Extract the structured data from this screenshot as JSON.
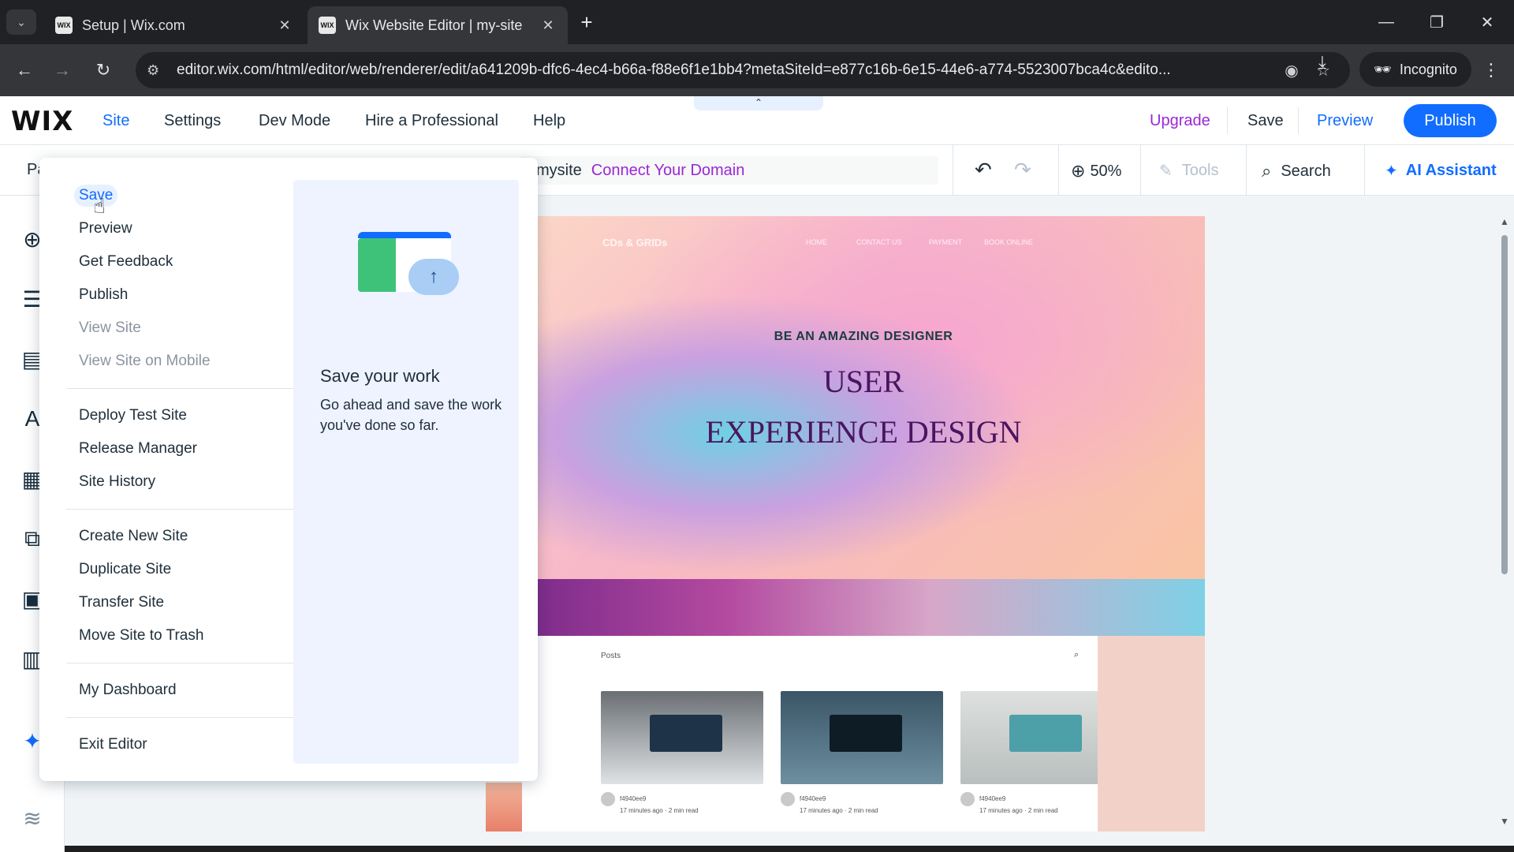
{
  "browser": {
    "tabs": [
      {
        "title": "Setup | Wix.com",
        "favicon": "WIX"
      },
      {
        "title": "Wix Website Editor | my-site",
        "favicon": "WIX"
      }
    ],
    "url": "editor.wix.com/html/editor/web/renderer/edit/a641209b-dfc6-4ec4-b66a-f88e6f1e1bb4?metaSiteId=e877c16b-6e15-44e6-a774-5523007bca4c&edito...",
    "incognito_label": "Incognito"
  },
  "wix_top": {
    "logo": "WIX",
    "menu": [
      "Site",
      "Settings",
      "Dev Mode",
      "Hire a Professional",
      "Help"
    ],
    "upgrade": "Upgrade",
    "save": "Save",
    "preview": "Preview",
    "publish": "Publish"
  },
  "wix_bar2": {
    "page_label": "Pa",
    "site_name": "mysite",
    "connect_domain": "Connect Your Domain",
    "zoom": "50%",
    "tools": "Tools",
    "search": "Search",
    "ai_assistant": "AI Assistant"
  },
  "site_menu": {
    "group1": [
      "Save",
      "Preview",
      "Get Feedback",
      "Publish",
      "View Site",
      "View Site on Mobile"
    ],
    "group2": [
      "Deploy Test Site",
      "Release Manager",
      "Site History"
    ],
    "group3": [
      "Create New Site",
      "Duplicate Site",
      "Transfer Site",
      "Move Site to Trash"
    ],
    "group4": [
      "My Dashboard"
    ],
    "group5": [
      "Exit Editor"
    ],
    "info_title": "Save your work",
    "info_desc": "Go ahead and save the work you've done so far."
  },
  "site_preview": {
    "logo": "CDs & GRIDs",
    "nav": [
      "HOME",
      "CONTACT US",
      "PAYMENT",
      "BOOK ONLINE"
    ],
    "kicker": "BE AN AMAZING DESIGNER",
    "headline1": "USER",
    "headline2": "EXPERIENCE DESIGN",
    "posts_label": "Posts",
    "post_author": "f4940ee9",
    "post_meta": "17 minutes ago · 2 min read"
  },
  "colors": {
    "wix_blue": "#116dff",
    "upgrade_purple": "#9a27d5"
  }
}
